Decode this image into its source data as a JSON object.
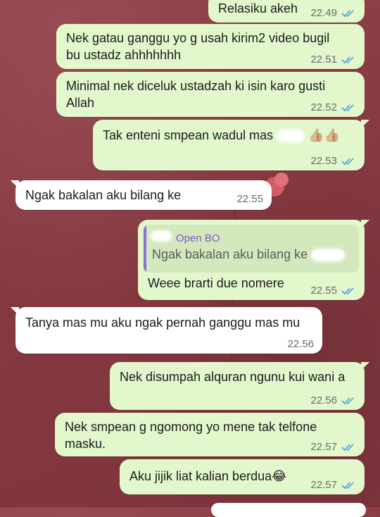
{
  "chat": {
    "messages": [
      {
        "direction": "out",
        "text": "Relasiku akeh",
        "time": "22.49",
        "status": "read"
      },
      {
        "direction": "out",
        "text_lines": [
          "Nek gatau ganggu yo g usah kirim2 video bugil",
          "bu ustadz ahhhhhhh"
        ],
        "time": "22.51",
        "status": "read"
      },
      {
        "direction": "out",
        "text_lines": [
          "Minimal nek diceluk ustadzah ki isin karo gusti",
          "Allah"
        ],
        "time": "22.52",
        "status": "read"
      },
      {
        "direction": "out",
        "text": "Tak enteni smpean wadul mas",
        "emoji": "👍🏼👍🏼",
        "time": "22.53",
        "status": "read"
      },
      {
        "direction": "in",
        "text": "Ngak bakalan aku bilang ke",
        "time": "22.55"
      },
      {
        "direction": "out",
        "reply_to": {
          "author": "Open BO",
          "text": "Ngak bakalan aku bilang ke"
        },
        "text": "Weee brarti due nomere",
        "time": "22.55",
        "status": "read"
      },
      {
        "direction": "in",
        "text": "Tanya mas mu aku ngak pernah ganggu mas mu",
        "time": "22.56"
      },
      {
        "direction": "out",
        "text": "Nek disumpah alquran ngunu kui wani a",
        "time": "22.56",
        "status": "read"
      },
      {
        "direction": "out",
        "text_lines": [
          "Nek smpean g ngomong yo mene tak telfone",
          "masku."
        ],
        "time": "22.57",
        "status": "read"
      },
      {
        "direction": "out",
        "text": "Aku jijik liat kalian berdua",
        "emoji": "😂",
        "time": "22.57",
        "status": "read"
      }
    ]
  },
  "colors": {
    "background": "#8b3d45",
    "outgoing_bubble": "#e2f7cb",
    "incoming_bubble": "#ffffff",
    "read_tick": "#53a6e0",
    "reply_bar": "#8f6cd6"
  },
  "icons": {
    "read_status": "double-check-icon"
  }
}
